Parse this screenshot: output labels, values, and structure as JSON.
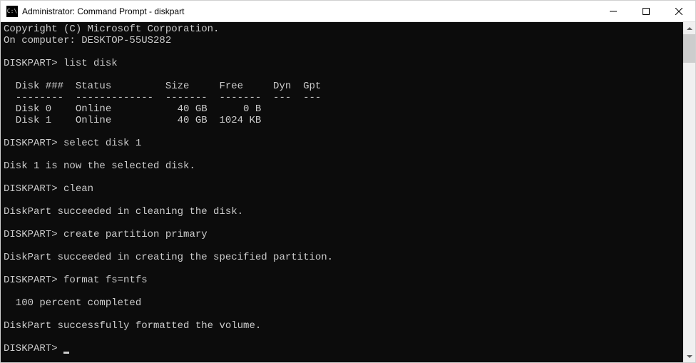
{
  "titlebar": {
    "icon_label": "C:\\",
    "title": "Administrator: Command Prompt - diskpart"
  },
  "terminal": {
    "copyright": "Copyright (C) Microsoft Corporation.",
    "on_computer": "On computer: DESKTOP-55US282",
    "prompt": "DISKPART>",
    "cmd_list_disk": "list disk",
    "table": {
      "header": "  Disk ###  Status         Size     Free     Dyn  Gpt",
      "divider": "  --------  -------------  -------  -------  ---  ---",
      "rows": [
        "  Disk 0    Online           40 GB      0 B",
        "  Disk 1    Online           40 GB  1024 KB"
      ]
    },
    "cmd_select_disk": "select disk 1",
    "msg_selected": "Disk 1 is now the selected disk.",
    "cmd_clean": "clean",
    "msg_clean": "DiskPart succeeded in cleaning the disk.",
    "cmd_create_partition": "create partition primary",
    "msg_create_partition": "DiskPart succeeded in creating the specified partition.",
    "cmd_format": "format fs=ntfs",
    "msg_progress": "  100 percent completed",
    "msg_format": "DiskPart successfully formatted the volume."
  }
}
